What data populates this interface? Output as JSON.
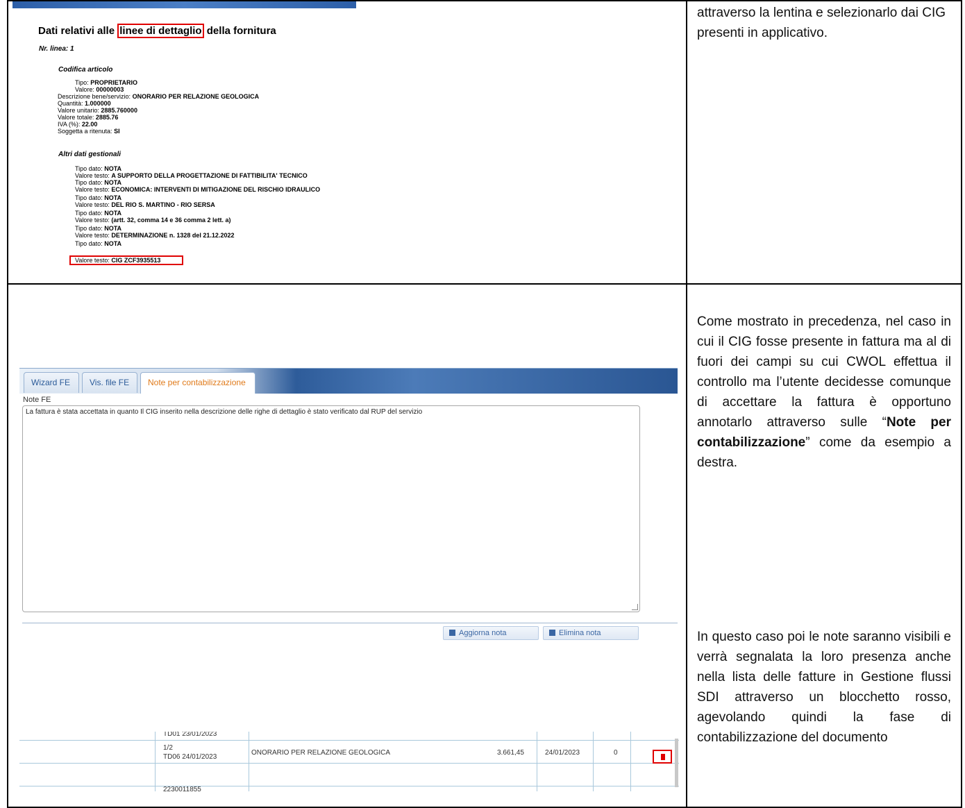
{
  "top_screenshot": {
    "title_before": "Dati relativi alle",
    "title_highlight": "linee di dettaglio",
    "title_after": "della fornitura",
    "line_number": "Nr. linea: 1",
    "section_codifica": "Codifica articolo",
    "section_altri": "Altri dati gestionali",
    "rows": [
      {
        "label": "Tipo:",
        "value": "PROPRIETARIO"
      },
      {
        "label": "Valore:",
        "value": "00000003"
      },
      {
        "label": "Descrizione bene/servizio:",
        "value": "ONORARIO PER RELAZIONE GEOLOGICA"
      },
      {
        "label": "Quantità:",
        "value": "1.000000"
      },
      {
        "label": "Valore unitario:",
        "value": "2885.760000"
      },
      {
        "label": "Valore totale:",
        "value": "2885.76"
      },
      {
        "label": "IVA (%):",
        "value": "22.00"
      },
      {
        "label": "Soggetta a ritenuta:",
        "value": "SI"
      }
    ],
    "gestionali": [
      {
        "label": "Tipo dato:",
        "value": "NOTA"
      },
      {
        "label": "Valore testo:",
        "value": "A SUPPORTO DELLA PROGETTAZIONE DI FATTIBILITA' TECNICO"
      },
      {
        "label": "Tipo dato:",
        "value": "NOTA"
      },
      {
        "label": "Valore testo:",
        "value": "ECONOMICA: INTERVENTI DI MITIGAZIONE DEL RISCHIO IDRAULICO"
      },
      {
        "label": "Tipo dato:",
        "value": "NOTA"
      },
      {
        "label": "Valore testo:",
        "value": "DEL RIO S. MARTINO - RIO SERSA"
      },
      {
        "label": "Tipo dato:",
        "value": "NOTA"
      },
      {
        "label": "Valore testo:",
        "value": "(artt. 32, comma 14 e 36 comma 2 lett. a)"
      },
      {
        "label": "Tipo dato:",
        "value": "NOTA"
      },
      {
        "label": "Valore testo:",
        "value": "DETERMINAZIONE n. 1328 del 21.12.2022"
      },
      {
        "label": "Tipo dato:",
        "value": "NOTA"
      },
      {
        "label": "Valore testo:",
        "value": "CIG ZCF3935513"
      }
    ]
  },
  "right_top_text": "attraverso la lentina e selezionarlo dai CIG presenti in applicativo.",
  "right_mid_text": {
    "part1": "Come mostrato in precedenza, nel caso in cui il CIG fosse presente in fattura ma al di fuori dei campi su cui CWOL effettua il controllo ma l’utente decidesse comunque di accettare la fattura è opportuno annotarlo attraverso sulle “",
    "bold": "Note per contabilizzazione",
    "part2": "” come da esempio a destra."
  },
  "right_bottom_text": "In questo caso poi le note saranno visibili e verrà segnalata la loro presenza anche nella lista delle fatture in Gestione flussi SDI attraverso un blocchetto rosso, agevolando quindi la fase di contabilizzazione del documento",
  "notes_screenshot": {
    "tabs": [
      "Wizard FE",
      "Vis. file FE",
      "Note per contabilizzazione"
    ],
    "note_label": "Note FE",
    "note_text": "La fattura è stata accettata in quanto Il CIG inserito nella descrizione delle righe di dettaglio  è stato verificato dal RUP del servizio",
    "update_button": "Aggiorna nota",
    "delete_button": "Elimina nota",
    "accent_color": "#e07a1a"
  },
  "list_screenshot": {
    "prev_row": "TD01   23/01/2023",
    "row_num": "1/2",
    "row_type_date": "TD06   24/01/2023",
    "description": "ONORARIO PER RELAZIONE GEOLOGICA",
    "amount": "3.661,45",
    "date": "24/01/2023",
    "count": "0",
    "next_row": "2230011855",
    "flag_color": "#e00000"
  }
}
